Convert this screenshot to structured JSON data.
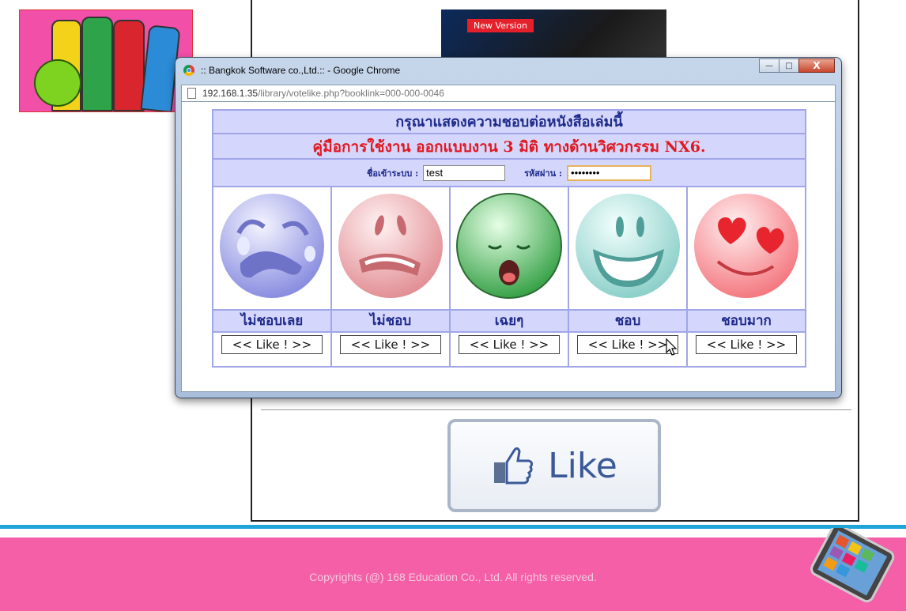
{
  "background": {
    "banner_tag": "New Version",
    "like_button_label": "Like",
    "footer_copyright": "Copyrights (@) 168 Education Co., Ltd. All rights reserved."
  },
  "popup": {
    "window_title": ":: Bangkok Software co.,Ltd.:: - Google Chrome",
    "url_host": "192.168.1.35",
    "url_path": "/library/votelike.php?booklink=000-000-0046",
    "buttons": {
      "minimize": "—",
      "maximize": "□",
      "close": "X"
    }
  },
  "vote": {
    "prompt": "กรุณาแสดงความชอบต่อหนังสือเล่มนี้",
    "book_title": "คู่มือการใช้งาน ออกแบบงาน 3 มิติ ทางด้านวิศวกรรม NX6.",
    "username_label": "ชื่อเข้าระบบ :",
    "username_value": "test",
    "password_label": "รหัสผ่าน :",
    "password_value": "••••••••",
    "options": [
      {
        "label": "ไม่ชอบเลย",
        "button": "<< Like ! >>",
        "face": "crying-face-icon",
        "color": "#9a9ee8"
      },
      {
        "label": "ไม่ชอบ",
        "button": "<< Like ! >>",
        "face": "frown-face-icon",
        "color": "#e8a3a8"
      },
      {
        "label": "เฉยๆ",
        "button": "<< Like ! >>",
        "face": "yawn-face-icon",
        "color": "#5ec86a"
      },
      {
        "label": "ชอบ",
        "button": "<< Like ! >>",
        "face": "grin-face-icon",
        "color": "#a8dcd8"
      },
      {
        "label": "ชอบมาก",
        "button": "<< Like ! >>",
        "face": "heart-eyes-face-icon",
        "color": "#f7838a"
      }
    ]
  }
}
